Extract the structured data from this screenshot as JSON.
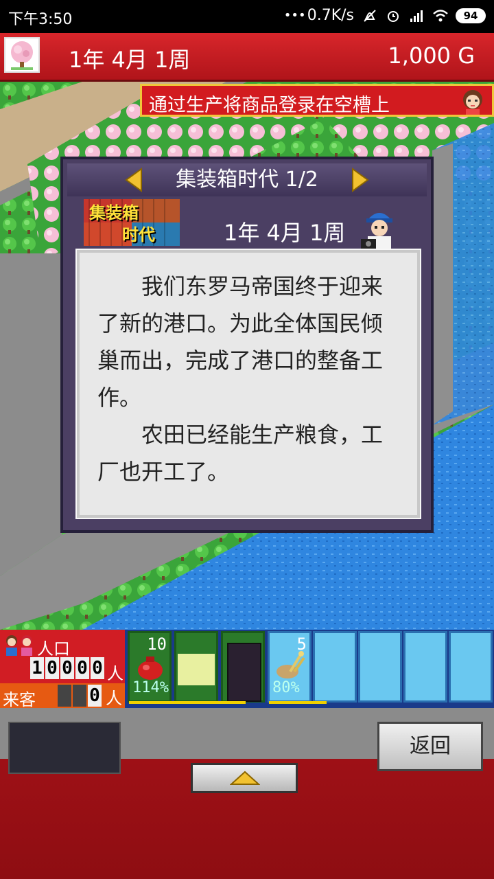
{
  "status_bar": {
    "time": "下午3:50",
    "network_speed": "0.7K/s",
    "battery": "94",
    "icons": [
      "more-dots-icon",
      "mute-icon",
      "alarm-icon",
      "signal-icon",
      "wifi-icon",
      "battery-icon"
    ]
  },
  "header": {
    "date": "1年  4月 1周",
    "money": "1,000 G",
    "left_icon": "cherry-blossom-icon"
  },
  "banner": {
    "text": "通过生产将商品登录在空槽上",
    "icon": "girl-portrait-icon"
  },
  "dialog": {
    "title": "集装箱时代 1/2",
    "era_logo_line1": "集装箱",
    "era_logo_line2": "时代",
    "era_date": "1年 4月 1周",
    "paragraphs": [
      "我们东罗马帝国终于迎来了新的港口。为此全体国民倾巢而出，完成了港口的整备工作。",
      "农田已经能生产粮食，工厂也开工了。"
    ]
  },
  "panel": {
    "population_label": "人口",
    "population_digits": [
      "1",
      "0",
      "0",
      "0",
      "0"
    ],
    "population_unit": "人",
    "visitors_label": "来客",
    "visitors_digits": [
      "",
      "",
      "0"
    ],
    "visitors_unit": "人",
    "slots": [
      {
        "type": "food",
        "count": "10",
        "percent": "114%",
        "icon": "red-bag-icon"
      },
      {
        "type": "empty-light"
      },
      {
        "type": "empty-dark"
      },
      {
        "type": "goods",
        "count": "5",
        "percent": "80%",
        "icon": "wheat-sack-icon"
      },
      {
        "type": "empty-blue"
      },
      {
        "type": "empty-blue"
      },
      {
        "type": "empty-blue"
      },
      {
        "type": "empty-blue"
      }
    ],
    "progress": {
      "food_bar": 0.85,
      "goods_bar": 0.6
    }
  },
  "bottom": {
    "back_label": "返回",
    "up_icon": "triangle-up-icon"
  },
  "colors": {
    "header_red": "#d8262b",
    "dialog_purple": "#4b3f63",
    "textbox_grey": "#e8e8e8",
    "water_blue": "#2f86e0",
    "grass_green": "#3cab3a"
  }
}
